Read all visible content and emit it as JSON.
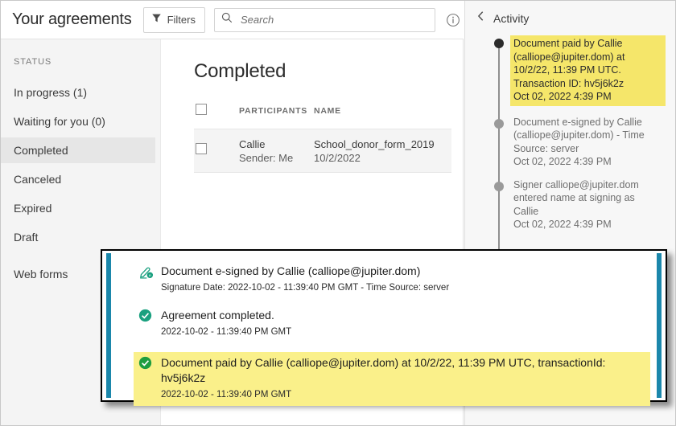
{
  "topbar": {
    "page_title": "Your agreements",
    "filters_label": "Filters",
    "filters_icon": "funnel-icon",
    "search_placeholder": "Search",
    "search_value": "",
    "search_icon": "search-icon",
    "info_icon": "info-circle-icon"
  },
  "sidebar": {
    "heading": "STATUS",
    "items": [
      {
        "label": "In progress (1)",
        "selected": false
      },
      {
        "label": "Waiting for you (0)",
        "selected": false
      },
      {
        "label": "Completed",
        "selected": true
      },
      {
        "label": "Canceled",
        "selected": false
      },
      {
        "label": "Expired",
        "selected": false
      },
      {
        "label": "Draft",
        "selected": false
      },
      {
        "label": "Web forms",
        "selected": false
      }
    ]
  },
  "main": {
    "title": "Completed",
    "columns": [
      "PARTICIPANTS",
      "NAME"
    ],
    "rows": [
      {
        "participant": "Callie",
        "participant_sub": "Sender: Me",
        "name": "School_donor_form_2019",
        "date": "10/2/2022"
      }
    ]
  },
  "activity": {
    "back_icon": "chevron-left-icon",
    "title": "Activity",
    "entries": [
      {
        "text": "Document paid by Callie (calliope@jupiter.dom) at 10/2/22, 11:39 PM UTC. Transaction ID: hv5j6k2z",
        "timestamp": "Oct 02, 2022 4:39 PM",
        "highlighted": true,
        "dot": "active"
      },
      {
        "text": "Document e-signed by Callie (calliope@jupiter.dom) - Time Source: server",
        "timestamp": "Oct 02, 2022 4:39 PM",
        "highlighted": false,
        "dot": "inactive"
      },
      {
        "text": "Signer calliope@jupiter.dom entered name at signing as Callie",
        "timestamp": "Oct 02, 2022 4:39 PM",
        "highlighted": false,
        "dot": "inactive"
      }
    ]
  },
  "overlay": {
    "entries": [
      {
        "icon": "signature-pen-icon",
        "title": "Document e-signed by Callie (calliope@jupiter.dom)",
        "sub": "Signature Date: 2022-10-02 - 11:39:40 PM GMT - Time Source: server",
        "highlighted": false
      },
      {
        "icon": "check-circle-icon",
        "title": "Agreement completed.",
        "sub": "2022-10-02 - 11:39:40 PM GMT",
        "highlighted": false
      },
      {
        "icon": "check-circle-icon",
        "title": "Document paid by Callie (calliope@jupiter.dom) at 10/2/22, 11:39 PM UTC, transactionId: hv5j6k2z",
        "sub": "2022-10-02 - 11:39:40 PM GMT",
        "highlighted": true
      }
    ]
  },
  "colors": {
    "highlight_yellow": "#faf08a",
    "activity_highlight_yellow": "#f5e66a",
    "accent_teal": "#1b87ab",
    "check_green": "#1f9d55",
    "check_teal": "#1aa07f",
    "sidebar_bg": "#f4f4f4"
  }
}
